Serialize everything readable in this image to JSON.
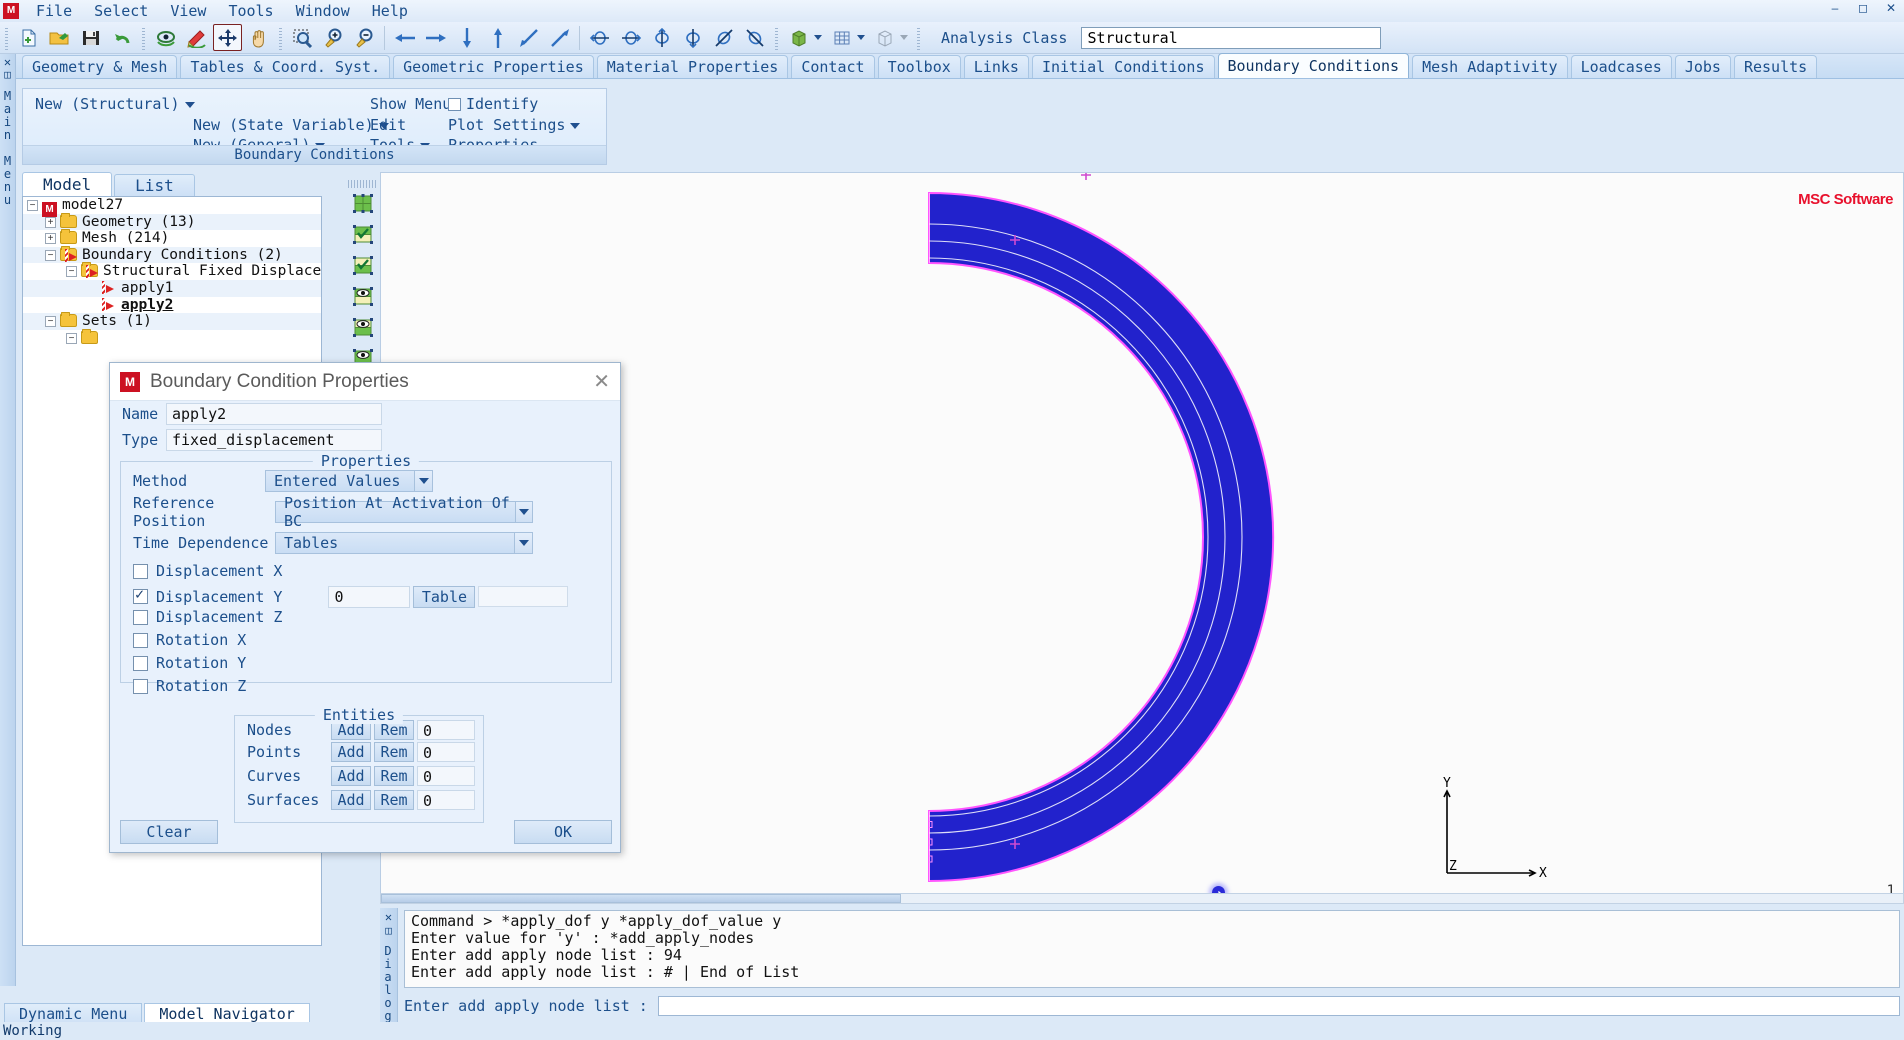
{
  "window": {
    "app_logo": "msc-logo",
    "controls": [
      "minimize",
      "maximize",
      "close"
    ]
  },
  "menubar": {
    "items": [
      "File",
      "Select",
      "View",
      "Tools",
      "Window",
      "Help"
    ]
  },
  "toolbar": {
    "groups": [
      {
        "icons": [
          "new-file-icon",
          "open-folder-icon",
          "save-icon",
          "undo-icon"
        ]
      },
      {
        "icons": [
          "view-rotate-icon",
          "edit-rotate-icon",
          "dynamic-move-icon",
          "pan-hand-icon"
        ]
      },
      {
        "icons": [
          "zoom-box-icon",
          "zoom-in-icon",
          "zoom-out-icon"
        ]
      },
      {
        "icons": [
          "arrow-left-icon",
          "arrow-right-icon",
          "arrow-down-icon",
          "arrow-up-icon",
          "arrow-back-diag-icon",
          "arrow-fwd-diag-icon"
        ]
      },
      {
        "icons": [
          "rotate-x-icon",
          "rotate-x2-icon",
          "rotate-y-icon",
          "rotate-y2-icon",
          "rotate-z-icon",
          "rotate-z2-icon"
        ]
      },
      {
        "icons": [
          "solid-view-icon",
          "wireframe-view-icon",
          "box-view-icon"
        ]
      }
    ],
    "analysis_class_label": "Analysis Class",
    "analysis_class_value": "Structural"
  },
  "tabs": {
    "items": [
      "Geometry & Mesh",
      "Tables & Coord. Syst.",
      "Geometric Properties",
      "Material Properties",
      "Contact",
      "Toolbox",
      "Links",
      "Initial Conditions",
      "Boundary Conditions",
      "Mesh Adaptivity",
      "Loadcases",
      "Jobs",
      "Results"
    ],
    "active": "Boundary Conditions"
  },
  "left_strip": {
    "label": "Main Menu"
  },
  "ribbon": {
    "new_structural": "New (Structural)",
    "new_state_variable": "New (State Variable)",
    "new_general": "New (General)",
    "show_menu": "Show Menu",
    "edit": "Edit",
    "tools": "Tools",
    "identify": "Identify",
    "identify_checked": false,
    "plot_settings": "Plot Settings",
    "properties": "Properties",
    "group_title": "Boundary Conditions"
  },
  "model_panel": {
    "tabs": [
      "Model",
      "List"
    ],
    "active_tab": "Model",
    "tree": [
      {
        "label": "model27",
        "depth": 0,
        "icon": "model-icon",
        "expander": "minus"
      },
      {
        "label": "Geometry (13)",
        "depth": 1,
        "icon": "folder-icon",
        "expander": "plus"
      },
      {
        "label": "Mesh (214)",
        "depth": 1,
        "icon": "folder-icon",
        "expander": "plus"
      },
      {
        "label": "Boundary Conditions (2)",
        "depth": 1,
        "icon": "folder-bc-icon",
        "expander": "minus"
      },
      {
        "label": "Structural Fixed Displace…",
        "depth": 2,
        "icon": "folder-bc-icon",
        "expander": "minus"
      },
      {
        "label": "apply1",
        "depth": 3,
        "icon": "bc-icon",
        "expander": "none"
      },
      {
        "label": "apply2",
        "depth": 3,
        "icon": "bc-icon",
        "expander": "none",
        "bold": true
      },
      {
        "label": "Sets (1)",
        "depth": 1,
        "icon": "folder-icon",
        "expander": "minus"
      }
    ]
  },
  "view_toolbar": {
    "buttons": [
      "show-all-icon",
      "check-green-icon",
      "check-yellow-icon",
      "eye-top-icon",
      "eye-bottom-icon",
      "plot-icon"
    ]
  },
  "dialog": {
    "title": "Boundary Condition Properties",
    "icon": "msc-app-icon",
    "close": "✕",
    "name_label": "Name",
    "name_value": "apply2",
    "type_label": "Type",
    "type_value": "fixed_displacement",
    "properties_group": "Properties",
    "method_label": "Method",
    "method_value": "Entered Values",
    "reference_position_label": "Reference Position",
    "reference_position_value": "Position At Activation Of BC",
    "time_dependence_label": "Time Dependence",
    "time_dependence_value": "Tables",
    "dofs": [
      {
        "label": "Displacement X",
        "checked": false,
        "value": "",
        "table_button": "",
        "table_value": ""
      },
      {
        "label": "Displacement Y",
        "checked": true,
        "value": "0",
        "table_button": "Table",
        "table_value": ""
      },
      {
        "label": "Displacement Z",
        "checked": false,
        "value": "",
        "table_button": "",
        "table_value": ""
      },
      {
        "label": "Rotation X",
        "checked": false,
        "value": "",
        "table_button": "",
        "table_value": ""
      },
      {
        "label": "Rotation Y",
        "checked": false,
        "value": "",
        "table_button": "",
        "table_value": ""
      },
      {
        "label": "Rotation Z",
        "checked": false,
        "value": "",
        "table_button": "",
        "table_value": ""
      }
    ],
    "entities_group": "Entities",
    "entities": [
      {
        "label": "Nodes",
        "add": "Add",
        "rem": "Rem",
        "count": "0"
      },
      {
        "label": "Points",
        "add": "Add",
        "rem": "Rem",
        "count": "0"
      },
      {
        "label": "Curves",
        "add": "Add",
        "rem": "Rem",
        "count": "0"
      },
      {
        "label": "Surfaces",
        "add": "Add",
        "rem": "Rem",
        "count": "0"
      }
    ],
    "clear_button": "Clear",
    "ok_button": "OK"
  },
  "viewport": {
    "logo": "MSC Software",
    "corner_number": "1",
    "axis": {
      "x": "X",
      "y": "Y",
      "z": "Z"
    },
    "mesh_color": "#2222cc",
    "outline_color": "#ff55ff"
  },
  "command_area": {
    "side_label": "Dialog",
    "lines": [
      "Command > *apply_dof y *apply_dof_value y",
      "Enter value for 'y' : *add_apply_nodes",
      "Enter add apply node list :  94",
      "Enter add apply node list : # | End of List"
    ],
    "prompt_label": "Enter add apply node list :",
    "prompt_value": ""
  },
  "bottom_tabs": {
    "items": [
      "Dynamic Menu",
      "Model Navigator"
    ],
    "active": "Model Navigator"
  },
  "statusbar": {
    "text": "Working"
  }
}
